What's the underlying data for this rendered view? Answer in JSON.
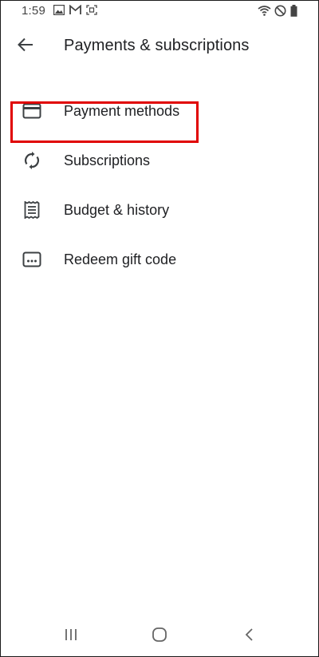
{
  "status_bar": {
    "time": "1:59",
    "icons": [
      "image-icon",
      "gmail-icon",
      "screenshot-icon",
      "wifi-icon",
      "do-not-disturb-icon",
      "battery-icon"
    ]
  },
  "app_bar": {
    "back_icon": "arrow-back-icon",
    "title": "Payments & subscriptions"
  },
  "menu": {
    "items": [
      {
        "label": "Payment methods",
        "icon": "credit-card-icon"
      },
      {
        "label": "Subscriptions",
        "icon": "sync-icon"
      },
      {
        "label": "Budget & history",
        "icon": "receipt-icon",
        "highlighted": true
      },
      {
        "label": "Redeem gift code",
        "icon": "gift-code-icon"
      }
    ]
  },
  "nav_bar": {
    "buttons": [
      "recents-icon",
      "home-icon",
      "back-icon"
    ]
  },
  "colors": {
    "highlight": "#e00000",
    "icon": "#5f6368",
    "text": "#202124"
  }
}
